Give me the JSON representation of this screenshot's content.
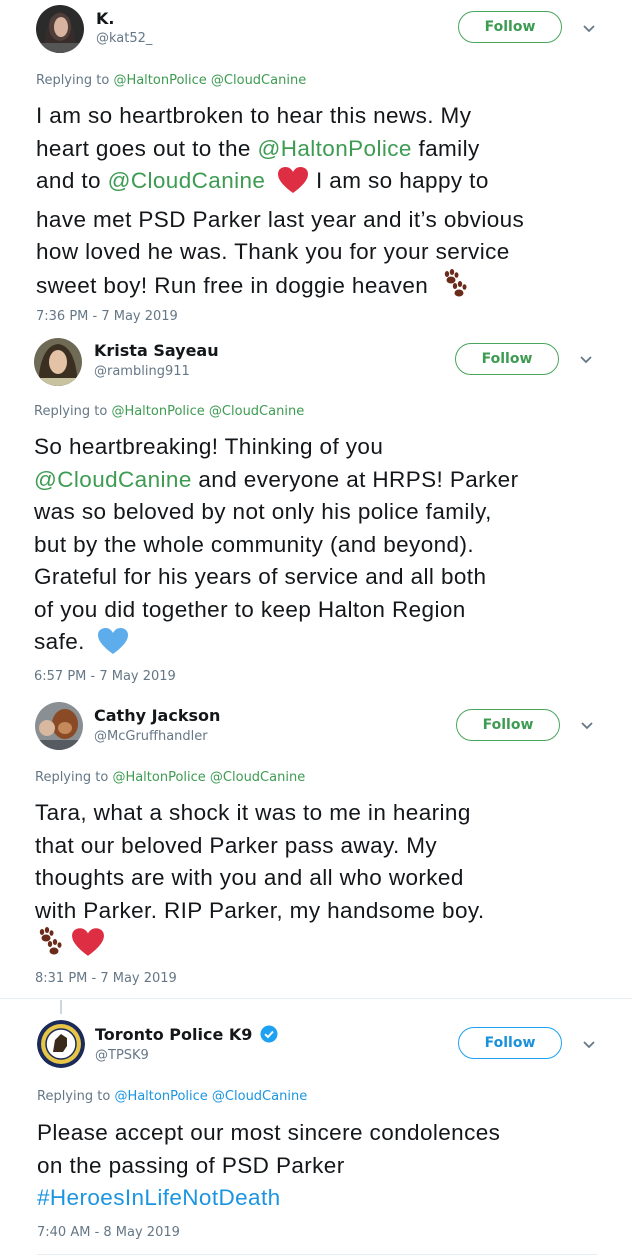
{
  "tweets": [
    {
      "name": "K.",
      "handle": "@kat52_",
      "follow_label": "Follow",
      "replying_prefix": "Replying to",
      "replying_to": [
        "@HaltonPolice",
        "@CloudCanine"
      ],
      "text": {
        "l1": "I am so heartbroken to hear this news. My",
        "l2a": "heart goes out to the ",
        "l2m": "@HaltonPolice",
        "l2b": " family",
        "l3a": "and to ",
        "l3m": "@CloudCanine",
        "l3b": " I am so happy to",
        "l4": "have met PSD Parker last year and it’s obvious",
        "l5": "how loved he was. Thank you for your service",
        "l6": "sweet boy! Run free in doggie heaven"
      },
      "timestamp": "7:36 PM - 7 May 2019"
    },
    {
      "name": "Krista Sayeau",
      "handle": "@rambling911",
      "follow_label": "Follow",
      "replying_prefix": "Replying to",
      "replying_to": [
        "@HaltonPolice",
        "@CloudCanine"
      ],
      "text": {
        "l1": "So heartbreaking! Thinking of you",
        "l2m": "@CloudCanine",
        "l2b": " and everyone at HRPS! Parker",
        "l3": "was so beloved by not only his police family,",
        "l4": "but by the whole community (and beyond).",
        "l5": "Grateful for his years of service and all both",
        "l6": "of you did together to keep Halton Region",
        "l7": "safe."
      },
      "timestamp": "6:57 PM - 7 May 2019"
    },
    {
      "name": "Cathy Jackson",
      "handle": "@McGruffhandler",
      "follow_label": "Follow",
      "replying_prefix": "Replying to",
      "replying_to": [
        "@HaltonPolice",
        "@CloudCanine"
      ],
      "text": {
        "l1": "Tara, what a shock it was to me in hearing",
        "l2": "that our beloved Parker pass away.  My",
        "l3": "thoughts are with you and all who worked",
        "l4": "with Parker.   RIP Parker, my handsome boy."
      },
      "timestamp": "8:31 PM - 7 May 2019"
    },
    {
      "name": "Toronto Police K9",
      "handle": "@TPSK9",
      "follow_label": "Follow",
      "replying_prefix": "Replying to",
      "replying_to": [
        "@HaltonPolice",
        "@CloudCanine"
      ],
      "text": {
        "l1": "Please accept our most sincere condolences",
        "l2": "on the passing of PSD Parker",
        "l3": "#HeroesInLifeNotDeath"
      },
      "timestamp": "7:40 AM - 8 May 2019"
    }
  ],
  "icons": [
    "red-heart-icon",
    "paw-prints-icon",
    "blue-heart-icon",
    "verified-badge-icon",
    "chevron-down-icon"
  ],
  "colors": {
    "mention_green": "#3d9b52",
    "link_blue": "#1b95e0",
    "follow_green": "#4aa55d"
  }
}
